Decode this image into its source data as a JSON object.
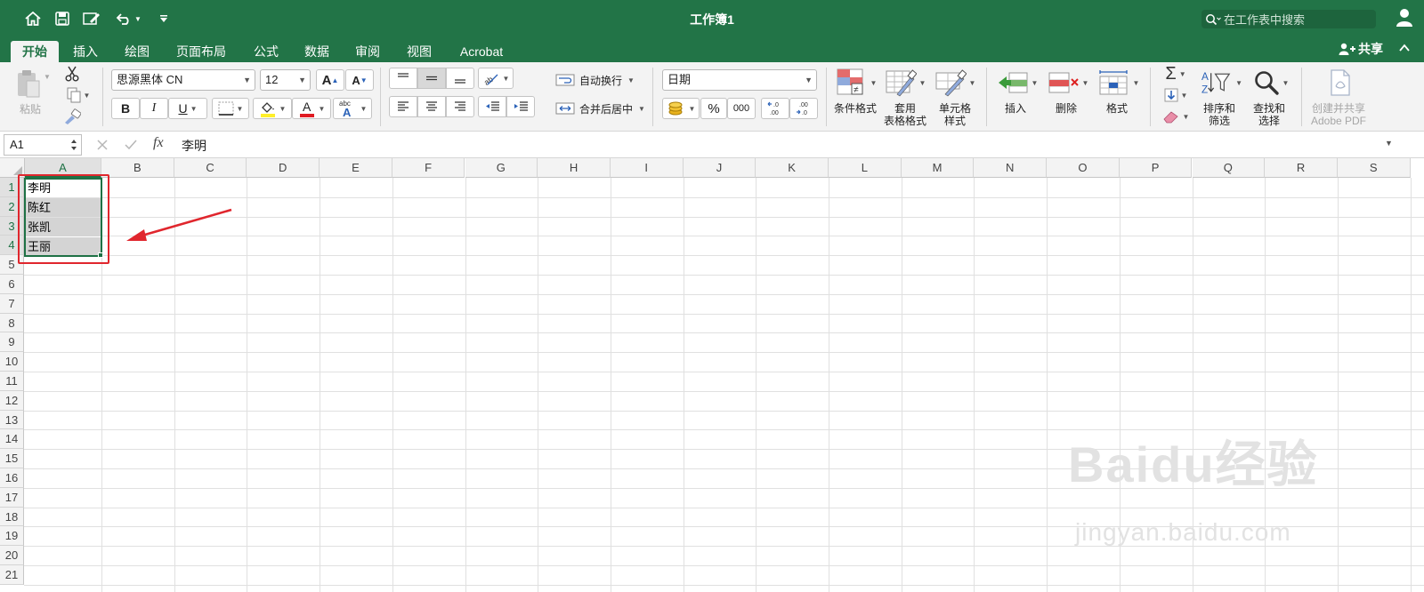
{
  "window": {
    "title": "工作簿1",
    "search_placeholder": "在工作表中搜索"
  },
  "tabs": [
    "开始",
    "插入",
    "绘图",
    "页面布局",
    "公式",
    "数据",
    "审阅",
    "视图",
    "Acrobat"
  ],
  "share_label": "共享",
  "ribbon": {
    "paste_label": "粘贴",
    "font_name": "思源黑体 CN",
    "font_size": "12",
    "bold": "B",
    "italic": "I",
    "underline": "U",
    "wrap_text": "自动换行",
    "merge_center": "合并后居中",
    "number_format": "日期",
    "percent": "%",
    "thousands": "000",
    "conditional_format": "条件格式",
    "table_format_1": "套用",
    "table_format_2": "表格格式",
    "cell_style_1": "单元格",
    "cell_style_2": "样式",
    "insert": "插入",
    "delete": "删除",
    "format": "格式",
    "sort_filter_1": "排序和",
    "sort_filter_2": "筛选",
    "find_select_1": "查找和",
    "find_select_2": "选择",
    "acrobat_1": "创建并共享",
    "acrobat_2": "Adobe PDF"
  },
  "formula_bar": {
    "name_box": "A1",
    "fx": "fx",
    "content": "李明"
  },
  "columns": [
    "A",
    "B",
    "C",
    "D",
    "E",
    "F",
    "G",
    "H",
    "I",
    "J",
    "K",
    "L",
    "M",
    "N",
    "O",
    "P",
    "Q",
    "R",
    "S"
  ],
  "rows": [
    "1",
    "2",
    "3",
    "4",
    "5",
    "6",
    "7",
    "8",
    "9",
    "10",
    "11",
    "12",
    "13",
    "14",
    "15",
    "16",
    "17",
    "18",
    "19",
    "20",
    "21"
  ],
  "cells": {
    "A1": "李明",
    "A2": "陈红",
    "A3": "张凯",
    "A4": "王丽"
  },
  "watermark": {
    "brand": "Baidu经验",
    "url": "jingyan.baidu.com"
  },
  "colors": {
    "accent": "#227447",
    "selection_border": "#1e7145",
    "annotation": "#e0262d"
  }
}
